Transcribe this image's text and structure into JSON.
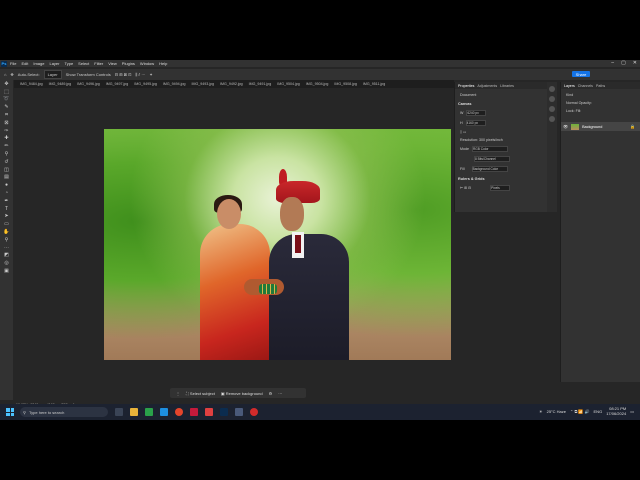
{
  "app": {
    "logo_label": "Ps"
  },
  "menubar": {
    "items": [
      "File",
      "Edit",
      "Image",
      "Layer",
      "Type",
      "Select",
      "Filter",
      "View",
      "Plugins",
      "Window",
      "Help"
    ]
  },
  "window_controls": [
    "–",
    "▢",
    "✕"
  ],
  "options": {
    "auto_select": "Auto-Select:",
    "layer": "Layer",
    "show_transform": "Show Transform Controls",
    "share": "Share"
  },
  "tabs": [
    "IMG_9484.jpg",
    "IMG_9489.jpg",
    "IMG_9496.jpg",
    "IMG_9497.jpg",
    "IMG_9495.jpg",
    "IMG_9494.jpg",
    "IMG_9493.jpg",
    "IMG_9492.jpg",
    "IMG_9491.jpg",
    "IMG_9504.jpg",
    "IMG_9504.jpg",
    "IMG_9508.jpg",
    "IMG_9511.jpg",
    "IMG_9515.jpg"
  ],
  "contextual": {
    "select_subject": "Select subject",
    "remove_background": "Remove background"
  },
  "status": {
    "zoom": "19.62%",
    "dims": "6240 px x 4160 px (300 ppi)"
  },
  "properties": {
    "tabs": [
      "Properties",
      "Adjustments",
      "Libraries"
    ],
    "doc_label": "Document",
    "canvas_label": "Canvas",
    "width": "6240 px",
    "height": "4160 px",
    "resolution": "Resolution: 300 pixels/inch",
    "mode_label": "Mode",
    "mode": "RGB Color",
    "bits": "8 Bits/Channel",
    "fill_label": "Fill",
    "fill_value": "Background Color",
    "rulers_label": "Rulers & Grids",
    "unit": "Pixels"
  },
  "layers": {
    "tabs": [
      "Layers",
      "Channels",
      "Paths"
    ],
    "kind": "Kind",
    "mode": "Normal",
    "opacity": "Opacity:",
    "lock": "Lock:",
    "fill": "Fill:",
    "layer_name": "Background"
  },
  "taskbar": {
    "search": "Type here to search",
    "weather": "25°C  Haze",
    "lang": "ENG",
    "time": "08:21 PM",
    "date": "17/06/2024"
  }
}
